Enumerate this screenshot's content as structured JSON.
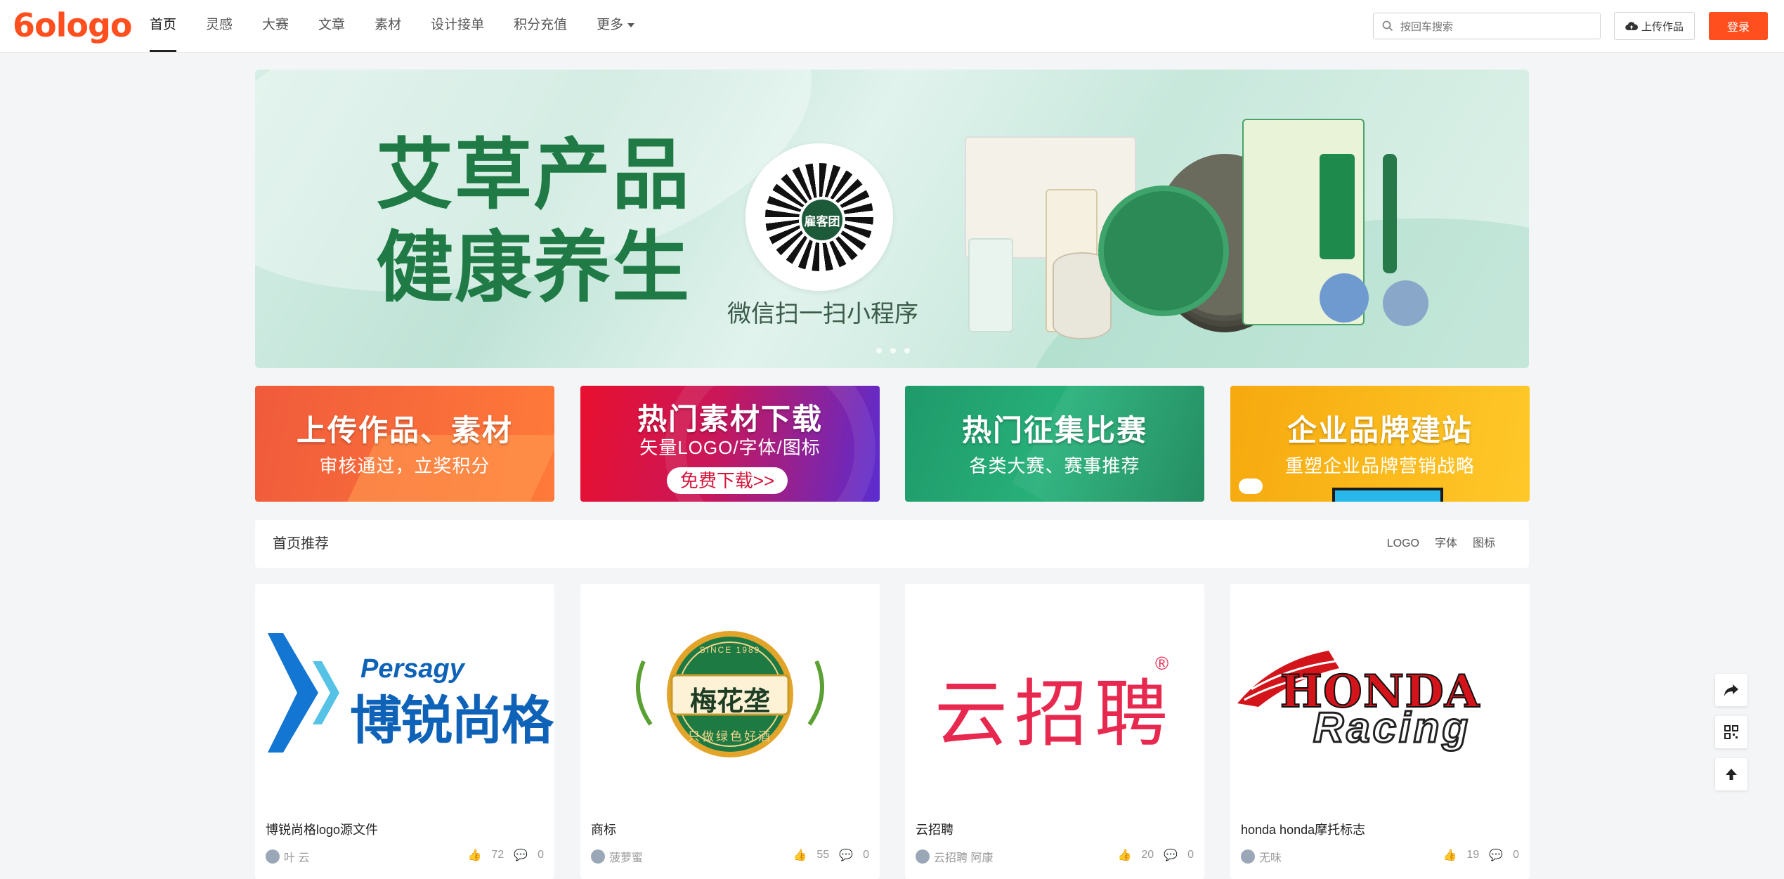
{
  "brand": {
    "logo_text": "6ologo",
    "accent": "#ff4f1f"
  },
  "nav": {
    "items": [
      "首页",
      "灵感",
      "大赛",
      "文章",
      "素材",
      "设计接单",
      "积分充值",
      "更多"
    ],
    "active": "首页"
  },
  "search": {
    "placeholder": "按回车搜索"
  },
  "header_actions": {
    "upload_label": "上传作品",
    "login_label": "登录"
  },
  "banner": {
    "title_line1": "艾草产品",
    "title_line2": "健康养生",
    "qr_label": "雇客团",
    "qr_caption": "微信扫一扫小程序",
    "slide_count": 3,
    "active_slide": 1
  },
  "promos": [
    {
      "title": "上传作品、素材",
      "subtitle": "审核通过，立奖积分"
    },
    {
      "title": "热门素材下载",
      "subtitle": "矢量LOGO/字体/图标",
      "button": "免费下载>>"
    },
    {
      "title": "热门征集比赛",
      "subtitle": "各类大赛、赛事推荐"
    },
    {
      "title": "企业品牌建站",
      "subtitle": "重塑企业品牌营销战略"
    }
  ],
  "section": {
    "title": "首页推荐",
    "tabs": [
      "LOGO",
      "字体",
      "图标"
    ]
  },
  "works": [
    {
      "title": "博锐尚格logo源文件",
      "author": "叶 云",
      "likes": "72",
      "comments": "0",
      "logo_text_en": "Persagy",
      "logo_text_cn": "博锐尚格"
    },
    {
      "title": "商标",
      "author": "菠萝蜜",
      "likes": "55",
      "comments": "0",
      "logo_text_top": "SINCE 1989",
      "logo_text_cn": "梅花垄",
      "logo_text_bottom": "只做绿色好酒"
    },
    {
      "title": "云招聘",
      "author": "云招聘 阿康",
      "likes": "20",
      "comments": "0",
      "logo_text_cn": "云招聘",
      "logo_mark": "®"
    },
    {
      "title": "honda honda摩托标志",
      "author": "无味",
      "likes": "19",
      "comments": "0",
      "logo_text_en": "HONDA",
      "logo_text_script": "Racing"
    }
  ],
  "colors": {
    "promo1": "#f4573a",
    "promo2": "#c3153f",
    "promo3": "#1f9a6a",
    "promo4": "#f7b410",
    "banner_green": "#1f7a45",
    "persagy_blue": "#0e62b8",
    "yunzhaopin_red": "#e8294f"
  }
}
